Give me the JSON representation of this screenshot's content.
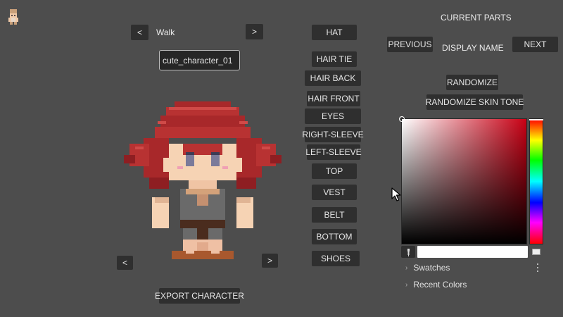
{
  "header": {
    "current_parts": "CURRENT PARTS",
    "display_name": "DISPLAY NAME"
  },
  "animation": {
    "prev_label": "<",
    "name": "Walk",
    "next_label": ">"
  },
  "name_field": {
    "value": "cute_character_01"
  },
  "direction": {
    "prev_label": "<",
    "next_label": ">"
  },
  "export_label": "EXPORT CHARACTER",
  "parts": [
    "HAT",
    "HAIR TIE",
    "HAIR BACK",
    "HAIR FRONT",
    "EYES",
    "RIGHT-SLEEVE",
    "LEFT-SLEEVE",
    "TOP",
    "VEST",
    "BELT",
    "BOTTOM",
    "SHOES"
  ],
  "nav": {
    "previous_label": "PREVIOUS",
    "next_label": "NEXT"
  },
  "actions": {
    "randomize_label": "RANDOMIZE",
    "randomize_skin_label": "RANDOMIZE SKIN TONE"
  },
  "color_picker": {
    "hue_color": "#c80014",
    "hex_value": "",
    "swatches_label": "Swatches",
    "recent_label": "Recent Colors"
  },
  "icons": {
    "app": "character-icon",
    "picker": "eyedropper-icon",
    "preview": "color-preview-icon",
    "menu": "kebab-menu-icon",
    "chevron": "chevron-right-icon",
    "cursor": "mouse-pointer-icon"
  }
}
